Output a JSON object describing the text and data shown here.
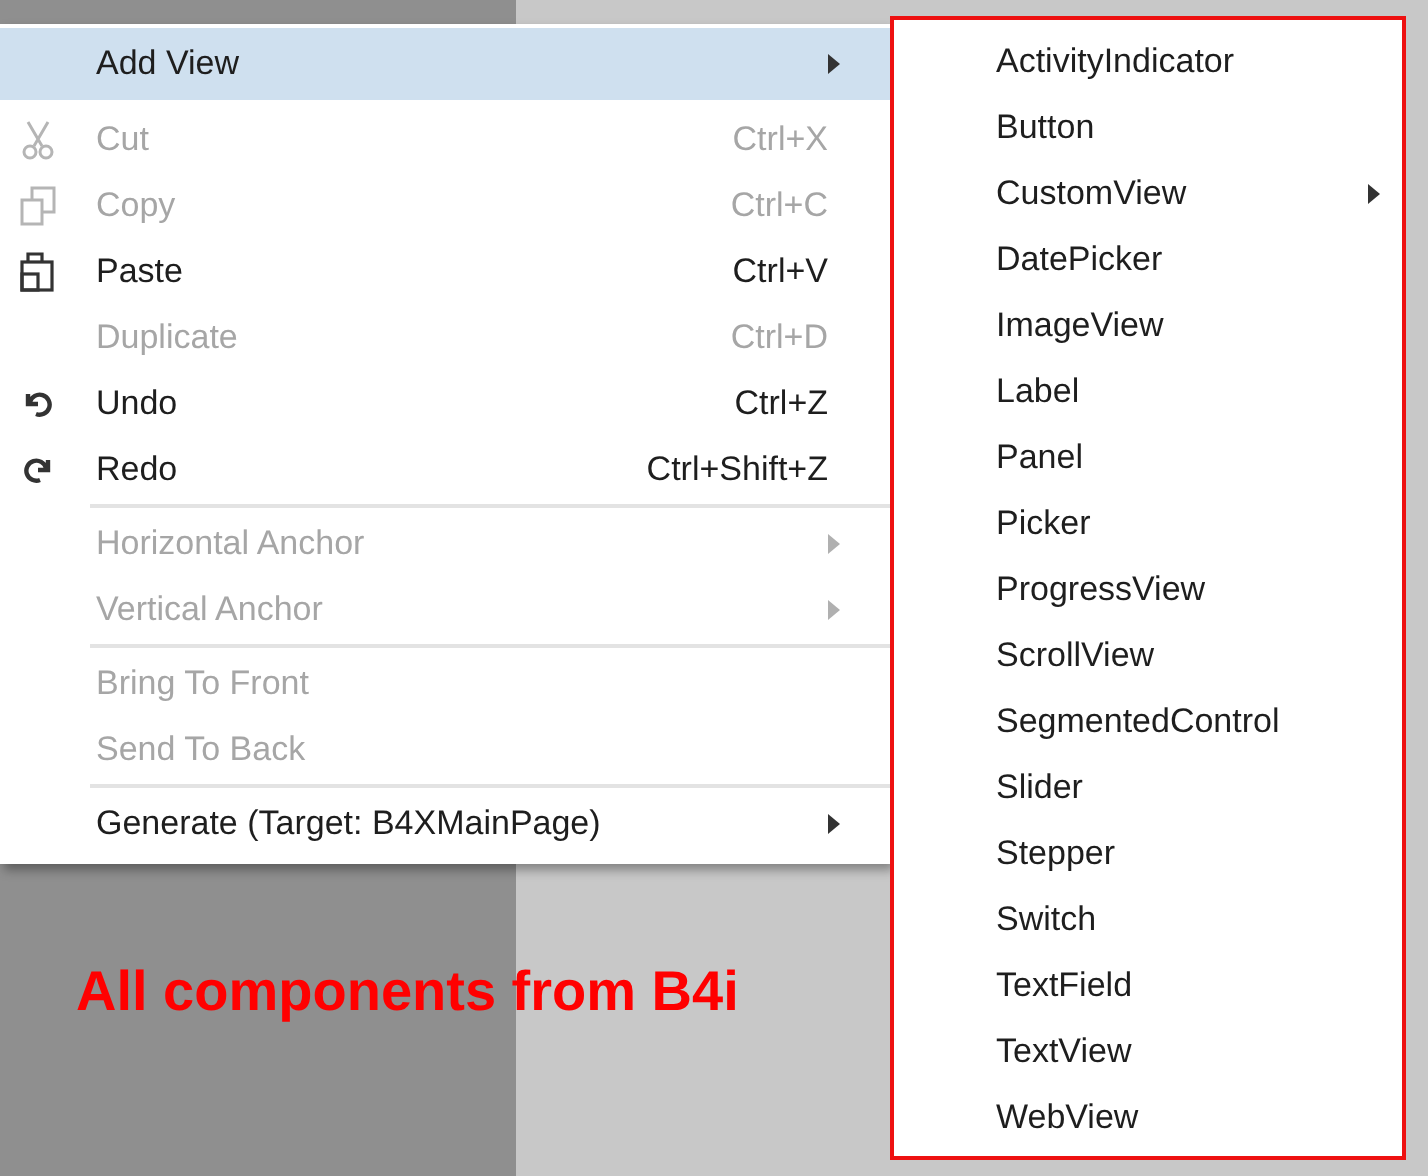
{
  "context_menu": {
    "items": [
      {
        "kind": "item",
        "label": "Add View",
        "disabled": false,
        "selected": true,
        "has_submenu": true
      },
      {
        "kind": "item",
        "label": "Cut",
        "shortcut": "Ctrl+X",
        "disabled": true,
        "selected": false,
        "has_submenu": false
      },
      {
        "kind": "item",
        "label": "Copy",
        "shortcut": "Ctrl+C",
        "disabled": true,
        "selected": false,
        "has_submenu": false
      },
      {
        "kind": "item",
        "label": "Paste",
        "shortcut": "Ctrl+V",
        "disabled": false,
        "selected": false,
        "has_submenu": false
      },
      {
        "kind": "item",
        "label": "Duplicate",
        "shortcut": "Ctrl+D",
        "disabled": true,
        "selected": false,
        "has_submenu": false
      },
      {
        "kind": "item",
        "label": "Undo",
        "shortcut": "Ctrl+Z",
        "disabled": false,
        "selected": false,
        "has_submenu": false
      },
      {
        "kind": "item",
        "label": "Redo",
        "shortcut": "Ctrl+Shift+Z",
        "disabled": false,
        "selected": false,
        "has_submenu": false
      },
      {
        "kind": "separator"
      },
      {
        "kind": "item",
        "label": "Horizontal Anchor",
        "disabled": true,
        "selected": false,
        "has_submenu": true
      },
      {
        "kind": "item",
        "label": "Vertical Anchor",
        "disabled": true,
        "selected": false,
        "has_submenu": true
      },
      {
        "kind": "separator"
      },
      {
        "kind": "item",
        "label": "Bring To Front",
        "disabled": true,
        "selected": false,
        "has_submenu": false
      },
      {
        "kind": "item",
        "label": "Send To Back",
        "disabled": true,
        "selected": false,
        "has_submenu": false
      },
      {
        "kind": "separator"
      },
      {
        "kind": "item",
        "label": "Generate (Target: B4XMainPage)",
        "disabled": false,
        "selected": false,
        "has_submenu": true
      }
    ]
  },
  "submenu": {
    "items": [
      {
        "label": "ActivityIndicator",
        "has_submenu": false
      },
      {
        "label": "Button",
        "has_submenu": false
      },
      {
        "label": "CustomView",
        "has_submenu": true
      },
      {
        "label": "DatePicker",
        "has_submenu": false
      },
      {
        "label": "ImageView",
        "has_submenu": false
      },
      {
        "label": "Label",
        "has_submenu": false
      },
      {
        "label": "Panel",
        "has_submenu": false
      },
      {
        "label": "Picker",
        "has_submenu": false
      },
      {
        "label": "ProgressView",
        "has_submenu": false
      },
      {
        "label": "ScrollView",
        "has_submenu": false
      },
      {
        "label": "SegmentedControl",
        "has_submenu": false
      },
      {
        "label": "Slider",
        "has_submenu": false
      },
      {
        "label": "Stepper",
        "has_submenu": false
      },
      {
        "label": "Switch",
        "has_submenu": false
      },
      {
        "label": "TextField",
        "has_submenu": false
      },
      {
        "label": "TextView",
        "has_submenu": false
      },
      {
        "label": "WebView",
        "has_submenu": false
      }
    ]
  },
  "annotation": {
    "text": "All components from B4i"
  }
}
